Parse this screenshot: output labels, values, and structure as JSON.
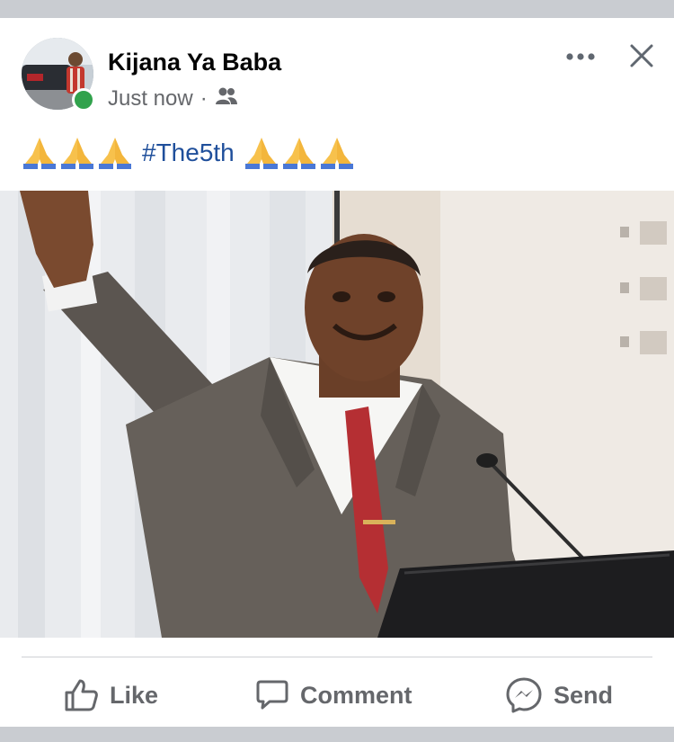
{
  "post": {
    "author": "Kijana Ya Baba",
    "timestamp": "Just now",
    "separator": "·",
    "audience_icon": "friends-icon",
    "online_status": "online",
    "text": {
      "prefix_emoji": "🙏🙏🙏",
      "hashtag": "#The5th",
      "suffix_emoji": "🙏🙏🙏"
    }
  },
  "header_actions": {
    "more_icon": "more-icon",
    "close_icon": "close-icon"
  },
  "actions": {
    "like_label": "Like",
    "comment_label": "Comment",
    "send_label": "Send"
  },
  "colors": {
    "name": "#050505",
    "meta": "#65676b",
    "hashtag": "#1f4f9b",
    "online": "#31a24c",
    "frame": "#c9ccd1"
  }
}
